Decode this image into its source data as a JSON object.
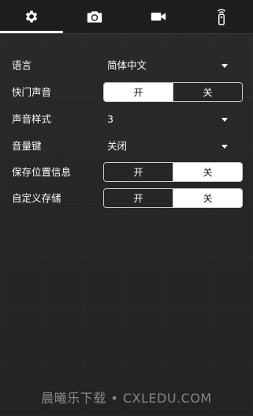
{
  "tabs": [
    {
      "icon": "gear-icon",
      "active": true
    },
    {
      "icon": "camera-icon",
      "active": false
    },
    {
      "icon": "video-camera-icon",
      "active": false
    },
    {
      "icon": "remote-control-icon",
      "active": false
    }
  ],
  "settings": {
    "language": {
      "label": "语言",
      "value": "简体中文"
    },
    "shutter_sound": {
      "label": "快门声音",
      "on": "开",
      "off": "关",
      "selected": "on"
    },
    "sound_style": {
      "label": "声音样式",
      "value": "3"
    },
    "volume_key": {
      "label": "音量键",
      "value": "关闭"
    },
    "save_location": {
      "label": "保存位置信息",
      "on": "开",
      "off": "关",
      "selected": "off"
    },
    "custom_storage": {
      "label": "自定义存储",
      "on": "开",
      "off": "关",
      "selected": "off"
    }
  },
  "watermark": "晨曦乐下载 • CXLEDU.COM",
  "colors": {
    "background": "#262626",
    "tabbar": "#1e1e1e",
    "selected": "#ffffff",
    "text": "#ffffff"
  }
}
